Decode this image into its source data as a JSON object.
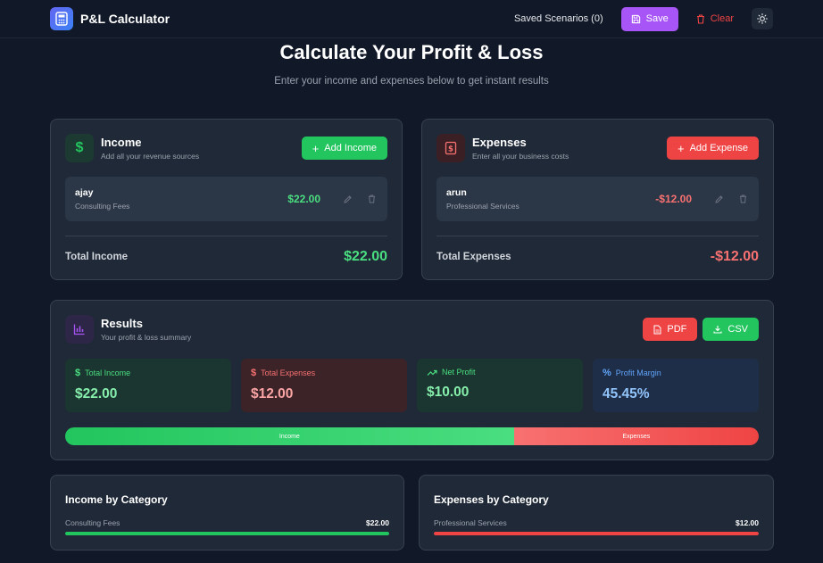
{
  "app": {
    "title": "P&L Calculator"
  },
  "header": {
    "saved_label": "Saved Scenarios (0)",
    "save_label": "Save",
    "clear_label": "Clear"
  },
  "hero": {
    "title": "Calculate Your Profit & Loss",
    "subtitle": "Enter your income and expenses below to get instant results"
  },
  "income": {
    "title": "Income",
    "subtitle": "Add all your revenue sources",
    "add_label": "Add Income",
    "entries": [
      {
        "name": "ajay",
        "category": "Consulting Fees",
        "amount": "$22.00"
      }
    ],
    "total_label": "Total Income",
    "total_value": "$22.00"
  },
  "expenses": {
    "title": "Expenses",
    "subtitle": "Enter all your business costs",
    "add_label": "Add Expense",
    "entries": [
      {
        "name": "arun",
        "category": "Professional Services",
        "amount": "-$12.00"
      }
    ],
    "total_label": "Total Expenses",
    "total_value": "-$12.00"
  },
  "results": {
    "title": "Results",
    "subtitle": "Your profit & loss summary",
    "pdf_label": "PDF",
    "csv_label": "CSV",
    "stats": [
      {
        "label": "Total Income",
        "value": "$22.00"
      },
      {
        "label": "Total Expenses",
        "value": "$12.00"
      },
      {
        "label": "Net Profit",
        "value": "$10.00"
      },
      {
        "label": "Profit Margin",
        "value": "45.45%"
      }
    ],
    "split": {
      "income_label": "Income",
      "expenses_label": "Expenses",
      "income_fraction": 0.647
    }
  },
  "income_by_category": {
    "title": "Income by Category",
    "rows": [
      {
        "label": "Consulting Fees",
        "value": "$22.00",
        "fraction": 1.0
      }
    ]
  },
  "expenses_by_category": {
    "title": "Expenses by Category",
    "rows": [
      {
        "label": "Professional Services",
        "value": "$12.00",
        "fraction": 1.0
      }
    ]
  },
  "colors": {
    "green": "#22c55e",
    "red": "#ef4444",
    "purple": "#a855f7",
    "blue": "#60a5fa",
    "background": "#111827",
    "card": "#1f2937"
  }
}
